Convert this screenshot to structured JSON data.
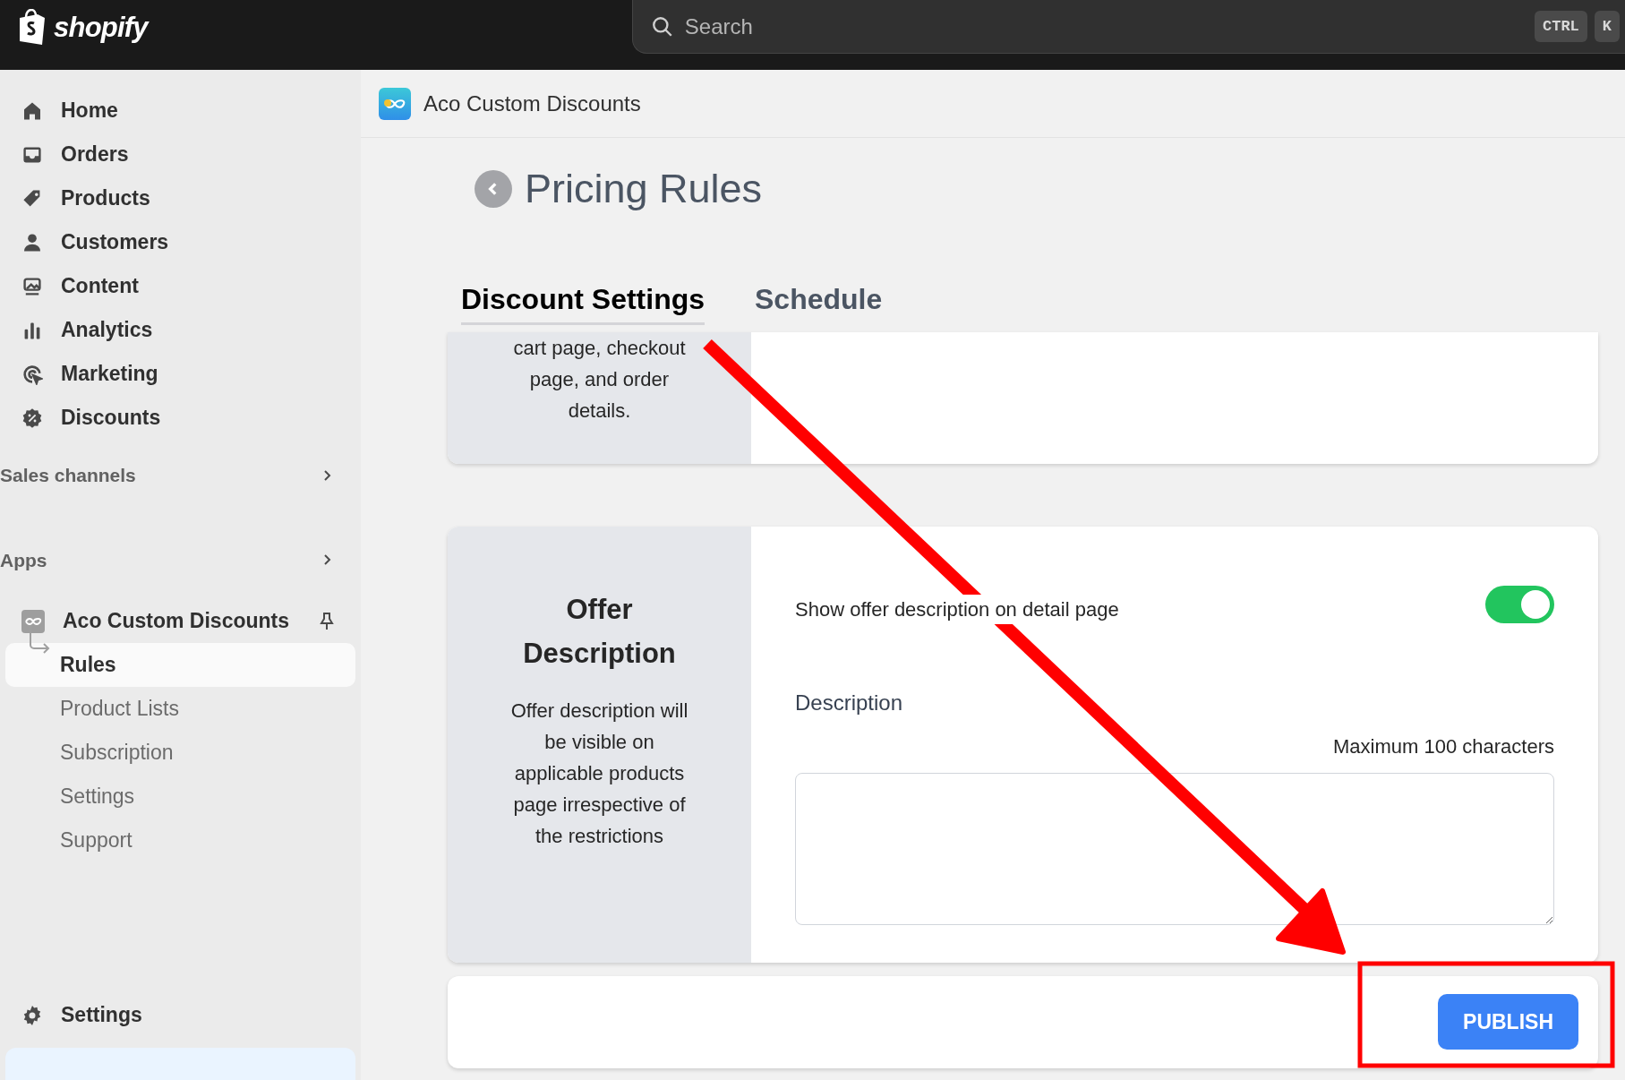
{
  "top_bar": {
    "logo": "shopify",
    "search": {
      "placeholder": "Search"
    },
    "shortcut_keys": [
      "CTRL",
      "K"
    ]
  },
  "sidebar": {
    "items": [
      {
        "label": "Home"
      },
      {
        "label": "Orders"
      },
      {
        "label": "Products"
      },
      {
        "label": "Customers"
      },
      {
        "label": "Content"
      },
      {
        "label": "Analytics"
      },
      {
        "label": "Marketing"
      },
      {
        "label": "Discounts"
      }
    ],
    "sections": [
      {
        "label": "Sales channels"
      },
      {
        "label": "Apps"
      }
    ],
    "app": {
      "name": "Aco Custom Discounts",
      "subitems": [
        {
          "label": "Rules",
          "selected": true
        },
        {
          "label": "Product Lists",
          "selected": false
        },
        {
          "label": "Subscription",
          "selected": false
        },
        {
          "label": "Settings",
          "selected": false
        },
        {
          "label": "Support",
          "selected": false
        }
      ]
    },
    "footer_item": {
      "label": "Settings"
    }
  },
  "app_header": {
    "title": "Aco Custom Discounts"
  },
  "page": {
    "title": "Pricing Rules",
    "tabs": [
      {
        "label": "Discount Settings",
        "selected": true
      },
      {
        "label": "Schedule",
        "selected": false
      }
    ],
    "sections": [
      {
        "description": "cart page, checkout page, and order details."
      },
      {
        "title": "Offer Description",
        "description": "Offer description will be visible on applicable products page irrespective of the restrictions",
        "toggle": {
          "label": "Show offer description on detail page",
          "on": true
        },
        "field": {
          "label": "Description",
          "hint": "Maximum 100 characters"
        }
      }
    ],
    "actions": [
      {
        "label": "PUBLISH"
      }
    ]
  }
}
